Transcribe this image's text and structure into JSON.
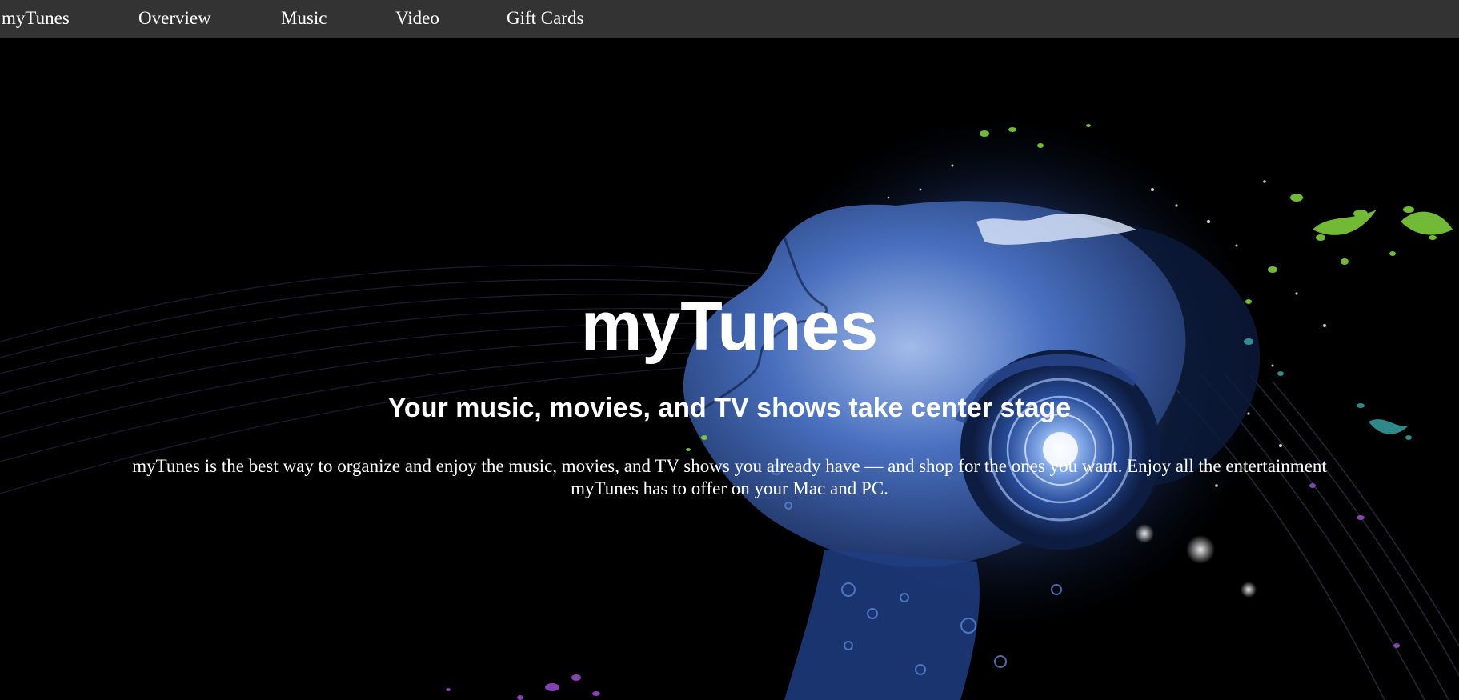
{
  "nav": {
    "brand": "myTunes",
    "items": [
      {
        "label": "Overview"
      },
      {
        "label": "Music"
      },
      {
        "label": "Video"
      },
      {
        "label": "Gift Cards"
      }
    ],
    "background": "#333333",
    "text_color": "#ffffff"
  },
  "hero": {
    "title": "myTunes",
    "subtitle": "Your music, movies, and TV shows take center stage",
    "body": "myTunes is the best way to organize and enjoy the music, movies, and TV shows you already have — and shop for the ones you want. Enjoy all the entertainment myTunes has to offer on your Mac and PC.",
    "background": "#000000",
    "text_color": "#ffffff",
    "image": "woman-with-headphones-splash-art"
  }
}
